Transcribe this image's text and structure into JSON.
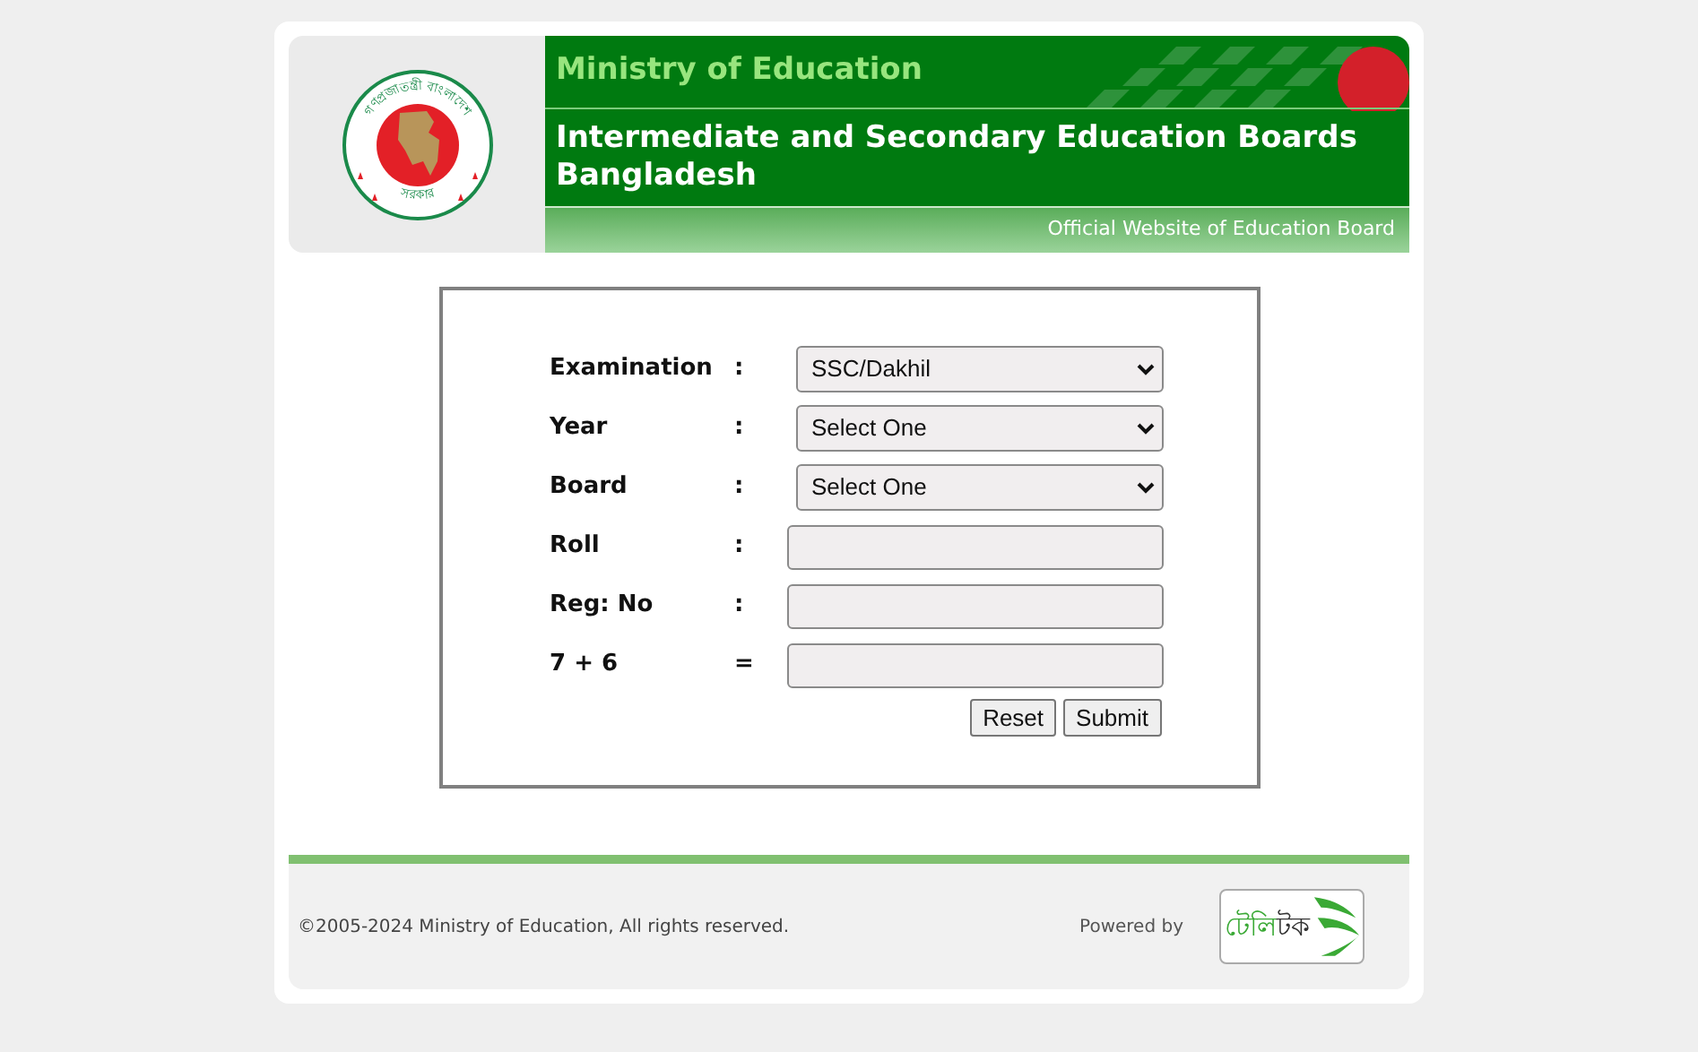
{
  "header": {
    "emblem_text_top": "গণপ্রজাতন্ত্রী বাংলাদেশ",
    "emblem_text_bottom": "সরকার",
    "ministry": "Ministry of Education",
    "title": "Intermediate and Secondary Education Boards Bangladesh",
    "tagline": "Official Website of Education Board"
  },
  "form": {
    "fields": [
      {
        "label": "Examination",
        "separator": ":",
        "kind": "select",
        "value": "SSC/Dakhil"
      },
      {
        "label": "Year",
        "separator": ":",
        "kind": "select",
        "value": "Select One"
      },
      {
        "label": "Board",
        "separator": ":",
        "kind": "select",
        "value": "Select One"
      },
      {
        "label": "Roll",
        "separator": ":",
        "kind": "text"
      },
      {
        "label": "Reg: No",
        "separator": ":",
        "kind": "text"
      },
      {
        "label": "7 + 6",
        "separator": "=",
        "kind": "text"
      }
    ],
    "buttons": [
      "Reset",
      "Submit"
    ]
  },
  "footer": {
    "copyright": "©2005-2024 Ministry of Education, All rights reserved.",
    "powered_by": "Powered by",
    "partner_logo": [
      {
        "text": "টেলি",
        "color": "#3aa935"
      },
      {
        "text": "টক",
        "color": "#333333"
      }
    ]
  }
}
